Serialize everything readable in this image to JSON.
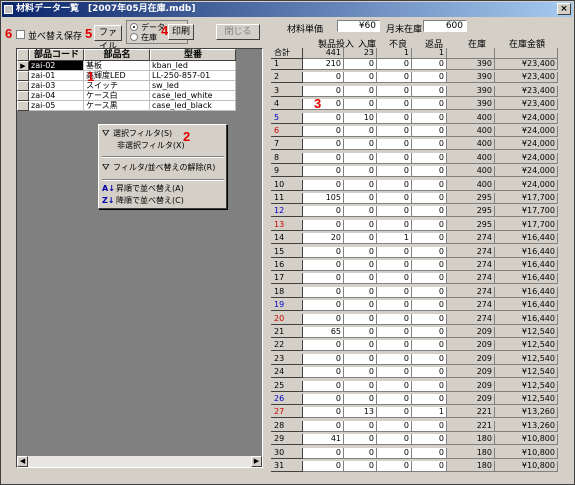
{
  "window": {
    "title": "材料データ一覧　[2007年05月在庫.mdb]",
    "close": "×"
  },
  "toolbar": {
    "sort_save_label": "並べ替え保存",
    "file_label": "ファイル",
    "radio_data": "データ",
    "radio_stock": "在庫",
    "print_label": "印刷",
    "close_label": "閉じる",
    "unit_price_label": "材料単価",
    "unit_price_value": "¥60",
    "month_end_label": "月末在庫",
    "month_end_value": "600"
  },
  "markers": [
    "1",
    "2",
    "3",
    "4",
    "5",
    "6"
  ],
  "left_table": {
    "headers": [
      "部品コード",
      "部品名",
      "型番"
    ],
    "rows": [
      {
        "code": "zai-02",
        "name": "基板",
        "model": "kban_led"
      },
      {
        "code": "zai-01",
        "name": "高輝度LED",
        "model": "LL-250-857-01"
      },
      {
        "code": "zai-03",
        "name": "スイッチ",
        "model": "sw_led"
      },
      {
        "code": "zai-04",
        "name": "ケース白",
        "model": "case_led_white"
      },
      {
        "code": "zai-05",
        "name": "ケース黒",
        "model": "case_led_black"
      }
    ]
  },
  "context_menu": [
    "選択フィルタ(S)",
    "非選択フィルタ(X)",
    "フィルタ/並べ替えの解除(R)",
    "昇順で並べ替え(A)",
    "降順で並べ替え(C)"
  ],
  "right_table": {
    "headers": [
      "",
      "製品投入",
      "入庫",
      "不良",
      "返品",
      "在庫",
      "在庫金額"
    ],
    "total": {
      "label": "合計",
      "input": "441",
      "in": "23",
      "bad": "1",
      "ret": "1"
    },
    "day_colors": {
      "blue": "#0000cc",
      "red": "#cc0000",
      "black": "#000000"
    },
    "rows": [
      {
        "d": "1",
        "c": "black",
        "v": [
          "210",
          "0",
          "0",
          "0",
          "390",
          "¥23,400"
        ]
      },
      {
        "d": "2",
        "c": "black",
        "v": [
          "0",
          "0",
          "0",
          "0",
          "390",
          "¥23,400"
        ]
      },
      {
        "d": "3",
        "c": "black",
        "v": [
          "0",
          "0",
          "0",
          "0",
          "390",
          "¥23,400"
        ]
      },
      {
        "d": "4",
        "c": "black",
        "v": [
          "0",
          "0",
          "0",
          "0",
          "390",
          "¥23,400"
        ]
      },
      {
        "d": "5",
        "c": "blue",
        "v": [
          "0",
          "10",
          "0",
          "0",
          "400",
          "¥24,000"
        ]
      },
      {
        "d": "6",
        "c": "red",
        "v": [
          "0",
          "0",
          "0",
          "0",
          "400",
          "¥24,000"
        ]
      },
      {
        "d": "7",
        "c": "black",
        "v": [
          "0",
          "0",
          "0",
          "0",
          "400",
          "¥24,000"
        ]
      },
      {
        "d": "8",
        "c": "black",
        "v": [
          "0",
          "0",
          "0",
          "0",
          "400",
          "¥24,000"
        ]
      },
      {
        "d": "9",
        "c": "black",
        "v": [
          "0",
          "0",
          "0",
          "0",
          "400",
          "¥24,000"
        ]
      },
      {
        "d": "10",
        "c": "black",
        "v": [
          "0",
          "0",
          "0",
          "0",
          "400",
          "¥24,000"
        ]
      },
      {
        "d": "11",
        "c": "black",
        "v": [
          "105",
          "0",
          "0",
          "0",
          "295",
          "¥17,700"
        ]
      },
      {
        "d": "12",
        "c": "blue",
        "v": [
          "0",
          "0",
          "0",
          "0",
          "295",
          "¥17,700"
        ]
      },
      {
        "d": "13",
        "c": "red",
        "v": [
          "0",
          "0",
          "0",
          "0",
          "295",
          "¥17,700"
        ]
      },
      {
        "d": "14",
        "c": "black",
        "v": [
          "20",
          "0",
          "1",
          "0",
          "274",
          "¥16,440"
        ]
      },
      {
        "d": "15",
        "c": "black",
        "v": [
          "0",
          "0",
          "0",
          "0",
          "274",
          "¥16,440"
        ]
      },
      {
        "d": "16",
        "c": "black",
        "v": [
          "0",
          "0",
          "0",
          "0",
          "274",
          "¥16,440"
        ]
      },
      {
        "d": "17",
        "c": "black",
        "v": [
          "0",
          "0",
          "0",
          "0",
          "274",
          "¥16,440"
        ]
      },
      {
        "d": "18",
        "c": "black",
        "v": [
          "0",
          "0",
          "0",
          "0",
          "274",
          "¥16,440"
        ]
      },
      {
        "d": "19",
        "c": "blue",
        "v": [
          "0",
          "0",
          "0",
          "0",
          "274",
          "¥16,440"
        ]
      },
      {
        "d": "20",
        "c": "red",
        "v": [
          "0",
          "0",
          "0",
          "0",
          "274",
          "¥16,440"
        ]
      },
      {
        "d": "21",
        "c": "black",
        "v": [
          "65",
          "0",
          "0",
          "0",
          "209",
          "¥12,540"
        ]
      },
      {
        "d": "22",
        "c": "black",
        "v": [
          "0",
          "0",
          "0",
          "0",
          "209",
          "¥12,540"
        ]
      },
      {
        "d": "23",
        "c": "black",
        "v": [
          "0",
          "0",
          "0",
          "0",
          "209",
          "¥12,540"
        ]
      },
      {
        "d": "24",
        "c": "black",
        "v": [
          "0",
          "0",
          "0",
          "0",
          "209",
          "¥12,540"
        ]
      },
      {
        "d": "25",
        "c": "black",
        "v": [
          "0",
          "0",
          "0",
          "0",
          "209",
          "¥12,540"
        ]
      },
      {
        "d": "26",
        "c": "blue",
        "v": [
          "0",
          "0",
          "0",
          "0",
          "209",
          "¥12,540"
        ]
      },
      {
        "d": "27",
        "c": "red",
        "v": [
          "0",
          "13",
          "0",
          "1",
          "221",
          "¥13,260"
        ]
      },
      {
        "d": "28",
        "c": "black",
        "v": [
          "0",
          "0",
          "0",
          "0",
          "221",
          "¥13,260"
        ]
      },
      {
        "d": "29",
        "c": "black",
        "v": [
          "41",
          "0",
          "0",
          "0",
          "180",
          "¥10,800"
        ]
      },
      {
        "d": "30",
        "c": "black",
        "v": [
          "0",
          "0",
          "0",
          "0",
          "180",
          "¥10,800"
        ]
      },
      {
        "d": "31",
        "c": "black",
        "v": [
          "0",
          "0",
          "0",
          "0",
          "180",
          "¥10,800"
        ]
      }
    ]
  }
}
